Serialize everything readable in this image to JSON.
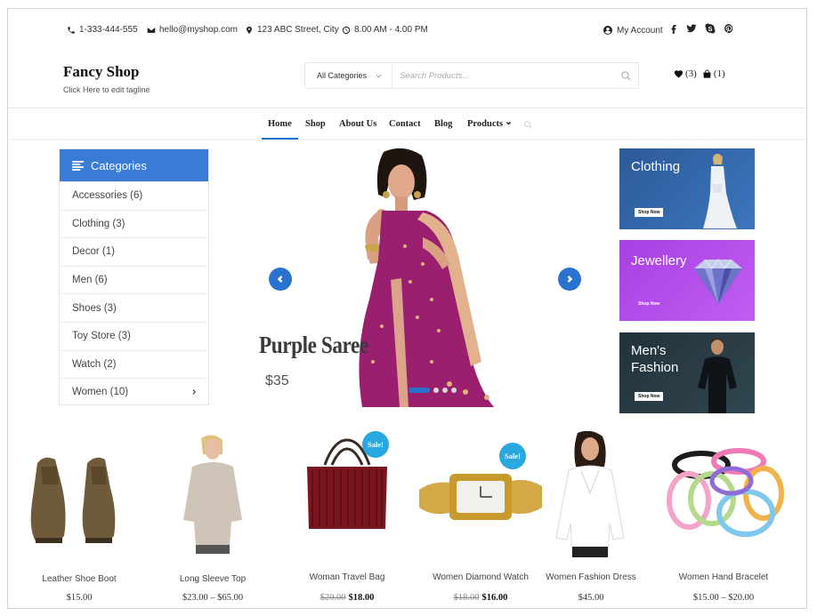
{
  "topbar": {
    "phone": "1-333-444-555",
    "email": "hello@myshop.com",
    "address": "123 ABC Street, City",
    "hours": "8.00 AM - 4.00 PM",
    "account_label": "My Account",
    "social_icons": [
      "facebook-icon",
      "twitter-icon",
      "skype-icon",
      "pinterest-icon"
    ]
  },
  "header": {
    "brand": "Fancy Shop",
    "tagline": "Click Here to edit tagline",
    "search": {
      "category": "All Categories",
      "placeholder": "Search Products..."
    },
    "wishlist_count": "(3)",
    "cart_count": "(1)"
  },
  "nav": {
    "items": [
      "Home",
      "Shop",
      "About Us",
      "Contact",
      "Blog",
      "Products"
    ],
    "active": "Home"
  },
  "categories": {
    "title": "Categories",
    "items": [
      "Accessories (6)",
      "Clothing (3)",
      "Decor (1)",
      "Men (6)",
      "Shoes (3)",
      "Toy Store (3)",
      "Watch (2)",
      "Women (10)"
    ]
  },
  "slider": {
    "title": "Purple Saree",
    "price": "$35",
    "slide_count": 4,
    "active_slide": 1
  },
  "banners": [
    {
      "title": "Clothing",
      "button": "Shop Now"
    },
    {
      "title": "Jewellery",
      "button": "Shop Now"
    },
    {
      "title": "Men's Fashion",
      "title_line1": "Men's",
      "title_line2": "Fashion",
      "button": "Shop Now"
    }
  ],
  "products": [
    {
      "name": "Leather Shoe Boot",
      "price": "$15.00",
      "sale": false
    },
    {
      "name": "Long Sleeve Top",
      "price": "$23.00 – $65.00",
      "sale": false
    },
    {
      "name": "Woman Travel Bag",
      "old_price": "$20.00",
      "price": "$18.00",
      "sale": true,
      "sale_label": "Sale!"
    },
    {
      "name": "Women Diamond Watch",
      "old_price": "$18.00",
      "price": "$16.00",
      "sale": true,
      "sale_label": "Sale!"
    },
    {
      "name": "Women Fashion Dress",
      "price": "$45.00",
      "sale": false
    },
    {
      "name": "Women Hand Bracelet",
      "price": "$15.00 – $20.00",
      "sale": false
    }
  ],
  "colors": {
    "accent": "#3a7bd5",
    "sale_badge": "#29a8e0",
    "clothing_banner": "#2f5f9f",
    "jewellery_banner": "#b14ee8",
    "mens_banner": "#27363f"
  }
}
